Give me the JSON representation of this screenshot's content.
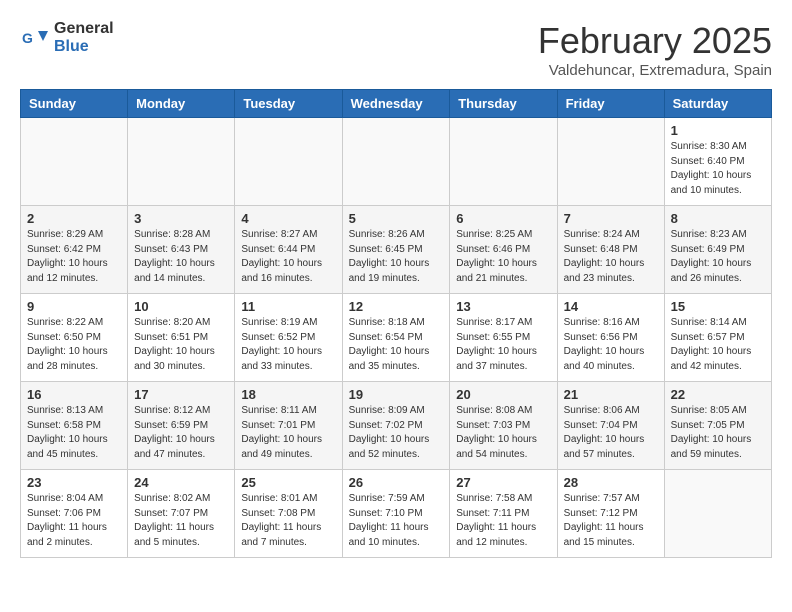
{
  "header": {
    "logo_general": "General",
    "logo_blue": "Blue",
    "month_title": "February 2025",
    "subtitle": "Valdehuncar, Extremadura, Spain"
  },
  "weekdays": [
    "Sunday",
    "Monday",
    "Tuesday",
    "Wednesday",
    "Thursday",
    "Friday",
    "Saturday"
  ],
  "weeks": [
    [
      {
        "day": "",
        "info": ""
      },
      {
        "day": "",
        "info": ""
      },
      {
        "day": "",
        "info": ""
      },
      {
        "day": "",
        "info": ""
      },
      {
        "day": "",
        "info": ""
      },
      {
        "day": "",
        "info": ""
      },
      {
        "day": "1",
        "info": "Sunrise: 8:30 AM\nSunset: 6:40 PM\nDaylight: 10 hours\nand 10 minutes."
      }
    ],
    [
      {
        "day": "2",
        "info": "Sunrise: 8:29 AM\nSunset: 6:42 PM\nDaylight: 10 hours\nand 12 minutes."
      },
      {
        "day": "3",
        "info": "Sunrise: 8:28 AM\nSunset: 6:43 PM\nDaylight: 10 hours\nand 14 minutes."
      },
      {
        "day": "4",
        "info": "Sunrise: 8:27 AM\nSunset: 6:44 PM\nDaylight: 10 hours\nand 16 minutes."
      },
      {
        "day": "5",
        "info": "Sunrise: 8:26 AM\nSunset: 6:45 PM\nDaylight: 10 hours\nand 19 minutes."
      },
      {
        "day": "6",
        "info": "Sunrise: 8:25 AM\nSunset: 6:46 PM\nDaylight: 10 hours\nand 21 minutes."
      },
      {
        "day": "7",
        "info": "Sunrise: 8:24 AM\nSunset: 6:48 PM\nDaylight: 10 hours\nand 23 minutes."
      },
      {
        "day": "8",
        "info": "Sunrise: 8:23 AM\nSunset: 6:49 PM\nDaylight: 10 hours\nand 26 minutes."
      }
    ],
    [
      {
        "day": "9",
        "info": "Sunrise: 8:22 AM\nSunset: 6:50 PM\nDaylight: 10 hours\nand 28 minutes."
      },
      {
        "day": "10",
        "info": "Sunrise: 8:20 AM\nSunset: 6:51 PM\nDaylight: 10 hours\nand 30 minutes."
      },
      {
        "day": "11",
        "info": "Sunrise: 8:19 AM\nSunset: 6:52 PM\nDaylight: 10 hours\nand 33 minutes."
      },
      {
        "day": "12",
        "info": "Sunrise: 8:18 AM\nSunset: 6:54 PM\nDaylight: 10 hours\nand 35 minutes."
      },
      {
        "day": "13",
        "info": "Sunrise: 8:17 AM\nSunset: 6:55 PM\nDaylight: 10 hours\nand 37 minutes."
      },
      {
        "day": "14",
        "info": "Sunrise: 8:16 AM\nSunset: 6:56 PM\nDaylight: 10 hours\nand 40 minutes."
      },
      {
        "day": "15",
        "info": "Sunrise: 8:14 AM\nSunset: 6:57 PM\nDaylight: 10 hours\nand 42 minutes."
      }
    ],
    [
      {
        "day": "16",
        "info": "Sunrise: 8:13 AM\nSunset: 6:58 PM\nDaylight: 10 hours\nand 45 minutes."
      },
      {
        "day": "17",
        "info": "Sunrise: 8:12 AM\nSunset: 6:59 PM\nDaylight: 10 hours\nand 47 minutes."
      },
      {
        "day": "18",
        "info": "Sunrise: 8:11 AM\nSunset: 7:01 PM\nDaylight: 10 hours\nand 49 minutes."
      },
      {
        "day": "19",
        "info": "Sunrise: 8:09 AM\nSunset: 7:02 PM\nDaylight: 10 hours\nand 52 minutes."
      },
      {
        "day": "20",
        "info": "Sunrise: 8:08 AM\nSunset: 7:03 PM\nDaylight: 10 hours\nand 54 minutes."
      },
      {
        "day": "21",
        "info": "Sunrise: 8:06 AM\nSunset: 7:04 PM\nDaylight: 10 hours\nand 57 minutes."
      },
      {
        "day": "22",
        "info": "Sunrise: 8:05 AM\nSunset: 7:05 PM\nDaylight: 10 hours\nand 59 minutes."
      }
    ],
    [
      {
        "day": "23",
        "info": "Sunrise: 8:04 AM\nSunset: 7:06 PM\nDaylight: 11 hours\nand 2 minutes."
      },
      {
        "day": "24",
        "info": "Sunrise: 8:02 AM\nSunset: 7:07 PM\nDaylight: 11 hours\nand 5 minutes."
      },
      {
        "day": "25",
        "info": "Sunrise: 8:01 AM\nSunset: 7:08 PM\nDaylight: 11 hours\nand 7 minutes."
      },
      {
        "day": "26",
        "info": "Sunrise: 7:59 AM\nSunset: 7:10 PM\nDaylight: 11 hours\nand 10 minutes."
      },
      {
        "day": "27",
        "info": "Sunrise: 7:58 AM\nSunset: 7:11 PM\nDaylight: 11 hours\nand 12 minutes."
      },
      {
        "day": "28",
        "info": "Sunrise: 7:57 AM\nSunset: 7:12 PM\nDaylight: 11 hours\nand 15 minutes."
      },
      {
        "day": "",
        "info": ""
      }
    ]
  ]
}
